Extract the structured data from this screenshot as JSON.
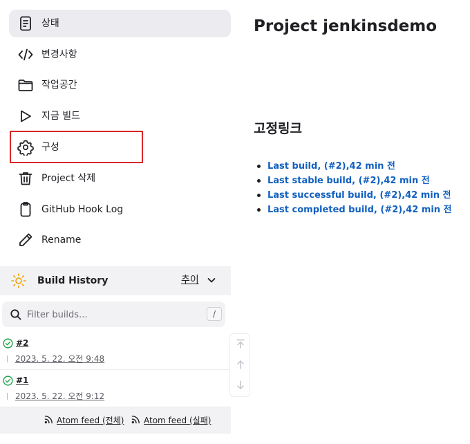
{
  "sidebar": {
    "items": [
      {
        "label": "상태",
        "icon": "document-icon"
      },
      {
        "label": "변경사항",
        "icon": "code-icon"
      },
      {
        "label": "작업공간",
        "icon": "folder-icon"
      },
      {
        "label": "지금 빌드",
        "icon": "play-icon"
      },
      {
        "label": "구성",
        "icon": "gear-icon"
      },
      {
        "label": "Project 삭제",
        "icon": "trash-icon"
      },
      {
        "label": "GitHub Hook Log",
        "icon": "clipboard-icon"
      },
      {
        "label": "Rename",
        "icon": "pencil-icon"
      }
    ]
  },
  "build_history": {
    "title": "Build History",
    "trend_label": "추이",
    "filter_placeholder": "Filter builds...",
    "filter_shortcut": "/",
    "builds": [
      {
        "number": "#2",
        "date": "2023. 5. 22. 오전 9:48",
        "status": "success"
      },
      {
        "number": "#1",
        "date": "2023. 5. 22. 오전 9:12",
        "status": "success"
      }
    ],
    "feeds": {
      "all": "Atom feed (전체)",
      "failed": "Atom feed (실패)"
    }
  },
  "main": {
    "title": "Project jenkinsdemo",
    "permalinks_title": "고정링크",
    "permalinks": [
      "Last build, (#2),42 min 전",
      "Last stable build, (#2),42 min 전",
      "Last successful build, (#2),42 min 전",
      "Last completed build, (#2),42 min 전"
    ]
  },
  "colors": {
    "link": "#1160c0",
    "success": "#1ea64b",
    "highlight_border": "#d62828",
    "sun": "#f0a000"
  }
}
